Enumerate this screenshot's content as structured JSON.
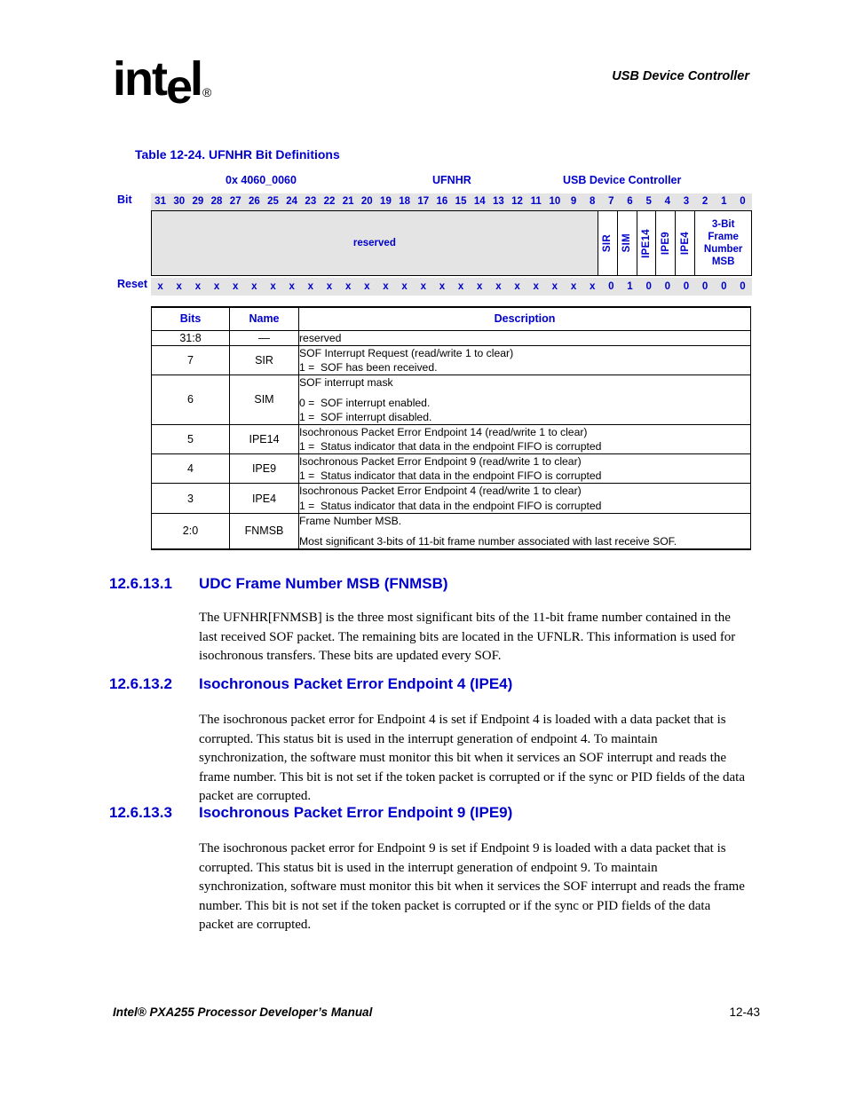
{
  "header": {
    "logo_text_1": "int",
    "logo_text_e": "e",
    "logo_text_2": "l",
    "logo_reg": "®",
    "running_head": "USB Device Controller"
  },
  "table_caption": "Table 12-24. UFNHR Bit Definitions",
  "register": {
    "address": "0x 4060_0060",
    "name": "UFNHR",
    "unit": "USB Device Controller",
    "bit_row_label": "Bit",
    "reset_row_label": "Reset",
    "bit_numbers": [
      "31",
      "30",
      "29",
      "28",
      "27",
      "26",
      "25",
      "24",
      "23",
      "22",
      "21",
      "20",
      "19",
      "18",
      "17",
      "16",
      "15",
      "14",
      "13",
      "12",
      "11",
      "10",
      "9",
      "8",
      "7",
      "6",
      "5",
      "4",
      "3",
      "2",
      "1",
      "0"
    ],
    "fields": [
      {
        "label": "reserved",
        "span": 24,
        "orientation": "horizontal",
        "shaded": true
      },
      {
        "label": "SIR",
        "span": 1,
        "orientation": "vertical",
        "shaded": false
      },
      {
        "label": "SIM",
        "span": 1,
        "orientation": "vertical",
        "shaded": false
      },
      {
        "label": "IPE14",
        "span": 1,
        "orientation": "vertical",
        "shaded": false
      },
      {
        "label": "IPE9",
        "span": 1,
        "orientation": "vertical",
        "shaded": false
      },
      {
        "label": "IPE4",
        "span": 1,
        "orientation": "vertical",
        "shaded": false
      },
      {
        "label": "3-Bit\nFrame\nNumber\nMSB",
        "span": 3,
        "orientation": "horizontal",
        "shaded": false
      }
    ],
    "reset_values": [
      "x",
      "x",
      "x",
      "x",
      "x",
      "x",
      "x",
      "x",
      "x",
      "x",
      "x",
      "x",
      "x",
      "x",
      "x",
      "x",
      "x",
      "x",
      "x",
      "x",
      "x",
      "x",
      "x",
      "x",
      "0",
      "1",
      "0",
      "0",
      "0",
      "0",
      "0",
      "0"
    ]
  },
  "desc_table": {
    "headers": [
      "Bits",
      "Name",
      "Description"
    ],
    "rows": [
      {
        "bits": "31:8",
        "name": "—",
        "desc_lines": [
          "reserved"
        ]
      },
      {
        "bits": "7",
        "name": "SIR",
        "desc_lines": [
          "SOF Interrupt Request (read/write 1 to clear)",
          "1 =  SOF has been received."
        ]
      },
      {
        "bits": "6",
        "name": "SIM",
        "desc_lines": [
          "SOF interrupt mask",
          "0 =  SOF interrupt enabled.",
          "1 =  SOF interrupt disabled."
        ]
      },
      {
        "bits": "5",
        "name": "IPE14",
        "desc_lines": [
          "Isochronous Packet Error Endpoint 14 (read/write 1 to clear)",
          "1 =  Status indicator that data in the endpoint FIFO is corrupted"
        ]
      },
      {
        "bits": "4",
        "name": "IPE9",
        "desc_lines": [
          "Isochronous Packet Error Endpoint 9 (read/write 1 to clear)",
          "1 =  Status indicator that data in the endpoint FIFO is corrupted"
        ]
      },
      {
        "bits": "3",
        "name": "IPE4",
        "desc_lines": [
          "Isochronous Packet Error Endpoint 4 (read/write 1 to clear)",
          "1 =  Status indicator that data in the endpoint FIFO is corrupted"
        ]
      },
      {
        "bits": "2:0",
        "name": "FNMSB",
        "desc_lines": [
          "Frame Number MSB.",
          "Most significant 3-bits of 11-bit frame number associated with last receive SOF."
        ]
      }
    ]
  },
  "sections": [
    {
      "number": "12.6.13.1",
      "title": "UDC Frame Number MSB (FNMSB)",
      "body": "The UFNHR[FNMSB] is the three most significant bits of the 11-bit frame number contained in the last received SOF packet. The remaining bits are located in the UFNLR. This information is used for isochronous transfers. These bits are updated every SOF."
    },
    {
      "number": "12.6.13.2",
      "title": "Isochronous Packet Error Endpoint 4 (IPE4)",
      "body": "The isochronous packet error for Endpoint 4 is set if Endpoint 4 is loaded with a data packet that is corrupted. This status bit is used in the interrupt generation of endpoint 4. To maintain synchronization, the software must monitor this bit when it services an SOF interrupt and reads the frame number. This bit is not set if the token packet is corrupted or if the sync or PID fields of the data packet are corrupted."
    },
    {
      "number": "12.6.13.3",
      "title": "Isochronous Packet Error Endpoint 9 (IPE9)",
      "body": "The isochronous packet error for Endpoint 9 is set if Endpoint 9 is loaded with a data packet that is corrupted. This status bit is used in the interrupt generation of endpoint 9. To maintain synchronization, software must monitor this bit when it services the SOF interrupt and reads the frame number. This bit is not set if the token packet is corrupted or if the sync or PID fields of the data packet are corrupted."
    }
  ],
  "footer": {
    "manual_title": "Intel® PXA255 Processor Developer’s Manual",
    "page_number": "12-43"
  },
  "colors": {
    "heading_blue": "#0000CC",
    "shaded_cell": "#e4e4e4",
    "text_black": "#000000"
  }
}
